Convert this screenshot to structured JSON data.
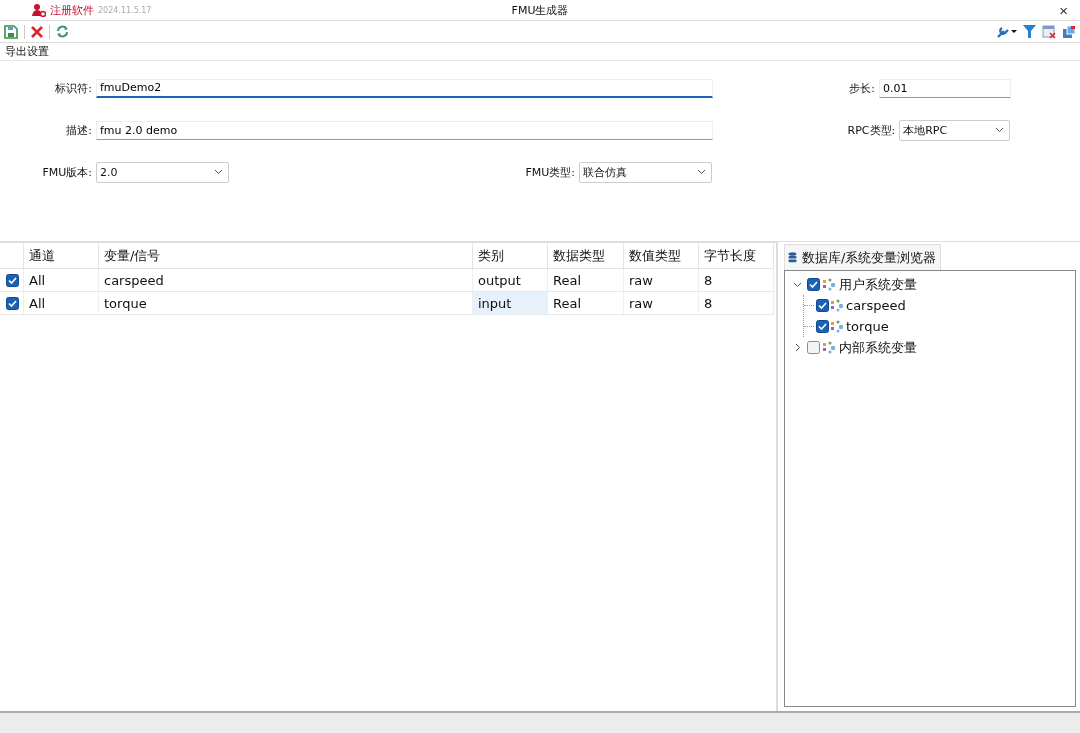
{
  "window": {
    "brand": "注册软件",
    "version": "2024.11.5.17",
    "title": "FMU生成器",
    "close": "×"
  },
  "group_title": "导出设置",
  "form": {
    "identifier": {
      "label": "标识符:",
      "value": "fmuDemo2",
      "focused": true
    },
    "step": {
      "label": "步长:",
      "value": "0.01",
      "focused": false
    },
    "description": {
      "label": "描述:",
      "value": "fmu 2.0 demo",
      "focused": false
    },
    "rpc_type": {
      "label": "RPC类型:",
      "value": "本地RPC"
    },
    "fmu_version": {
      "label": "FMU版本:",
      "value": "2.0"
    },
    "fmu_type": {
      "label": "FMU类型:",
      "value": "联合仿真"
    }
  },
  "table": {
    "columns": [
      "通道",
      "变量/信号",
      "类别",
      "数据类型",
      "数值类型",
      "字节长度"
    ],
    "rows": [
      {
        "checked": true,
        "selected": false,
        "cells": [
          "All",
          "carspeed",
          "output",
          "Real",
          "raw",
          "8"
        ]
      },
      {
        "checked": true,
        "selected": true,
        "cells": [
          "All",
          "torque",
          "input",
          "Real",
          "raw",
          "8"
        ]
      }
    ]
  },
  "browser": {
    "tab": "数据库/系统变量浏览器",
    "tree": [
      {
        "label": "用户系统变量",
        "checked": true,
        "expanded": true,
        "children": [
          {
            "label": "carspeed",
            "checked": true
          },
          {
            "label": "torque",
            "checked": true
          }
        ]
      },
      {
        "label": "内部系统变量",
        "checked": false,
        "expanded": false
      }
    ]
  }
}
